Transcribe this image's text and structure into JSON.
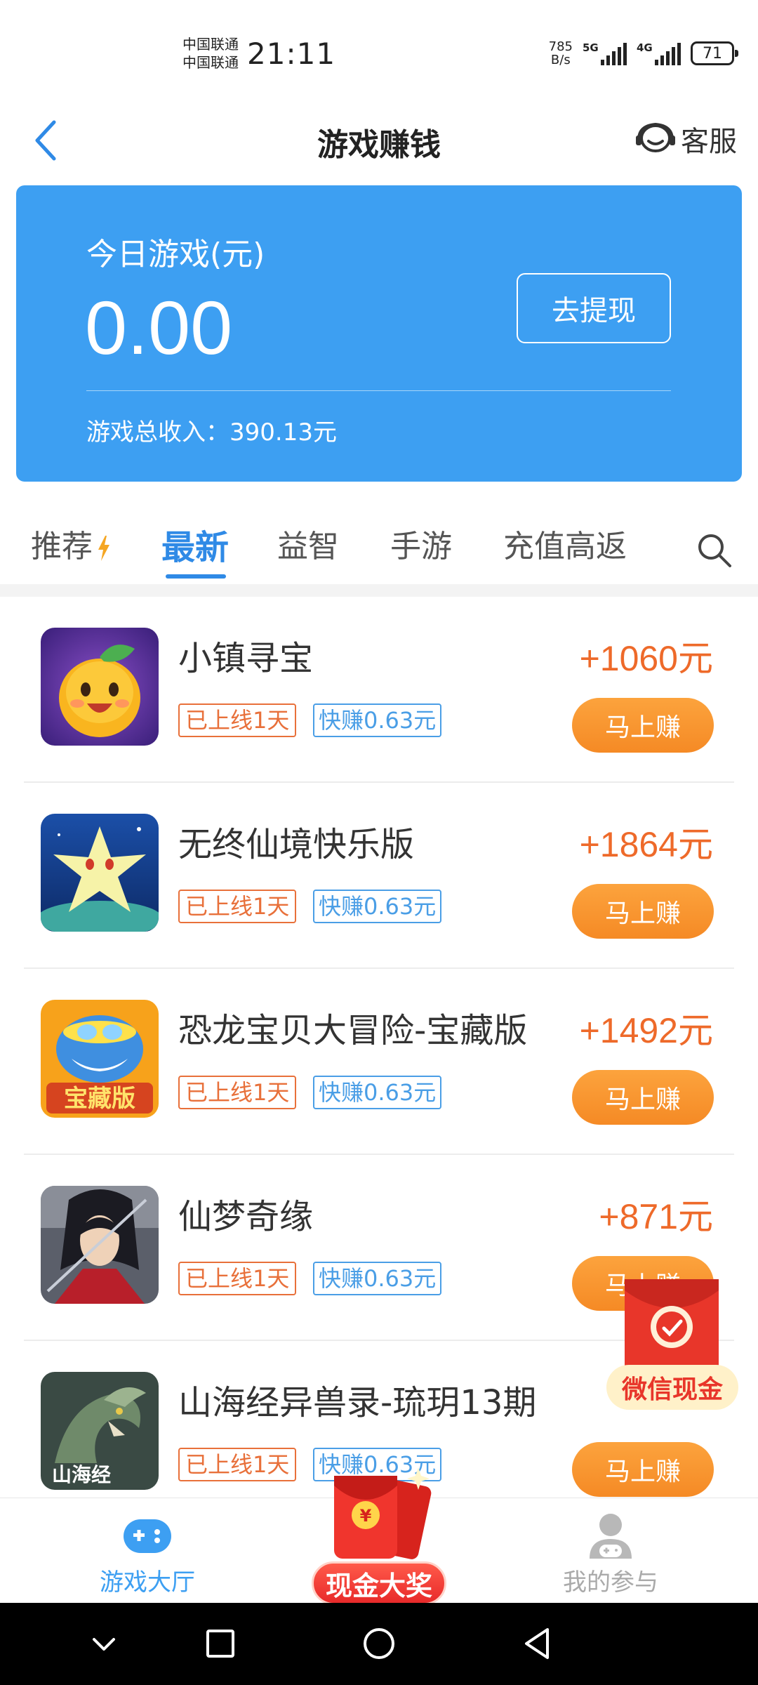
{
  "status_bar": {
    "carrier_1": "中国联通",
    "carrier_2": "中国联通",
    "time": "21:11",
    "net_speed_value": "785",
    "net_speed_unit": "B/s",
    "sig1_label": "5G",
    "sig2_label": "4G",
    "battery": "71"
  },
  "header": {
    "title": "游戏赚钱",
    "service_label": "客服"
  },
  "earnings": {
    "label": "今日游戏(元)",
    "amount": "0.00",
    "withdraw_label": "去提现",
    "total_label": "游戏总收入：390.13元"
  },
  "tabs": [
    {
      "label": "推荐"
    },
    {
      "label": "最新"
    },
    {
      "label": "益智"
    },
    {
      "label": "手游"
    },
    {
      "label": "充值高返"
    }
  ],
  "games": [
    {
      "name": "小镇寻宝",
      "online_tag": "已上线1天",
      "quick_tag": "快赚0.63元",
      "reward": "+1060元",
      "button": "马上赚"
    },
    {
      "name": "无终仙境快乐版",
      "online_tag": "已上线1天",
      "quick_tag": "快赚0.63元",
      "reward": "+1864元",
      "button": "马上赚"
    },
    {
      "name": "恐龙宝贝大冒险-宝藏版",
      "online_tag": "已上线1天",
      "quick_tag": "快赚0.63元",
      "reward": "+1492元",
      "button": "马上赚"
    },
    {
      "name": "仙梦奇缘",
      "online_tag": "已上线1天",
      "quick_tag": "快赚0.63元",
      "reward": "+871元",
      "button": "马上赚"
    },
    {
      "name": "山海经异兽录-琉玥13期",
      "online_tag": "已上线1天",
      "quick_tag": "快赚0.63元",
      "reward": "",
      "button": "马上赚"
    }
  ],
  "icon_texts": {
    "treasure_badge": "宝藏版",
    "shanhai_logo": "山海经"
  },
  "float_packet": {
    "label": "微信现金"
  },
  "bottom_nav": {
    "left_label": "游戏大厅",
    "center_label": "现金大奖",
    "right_label": "我的参与"
  },
  "colors": {
    "primary_blue": "#3d9ff2",
    "tab_active": "#2f8ae6",
    "reward_orange": "#ee6a2a",
    "button_orange": "#f58a25",
    "tag_orange": "#e8703a",
    "tag_blue": "#4a9ee6"
  }
}
